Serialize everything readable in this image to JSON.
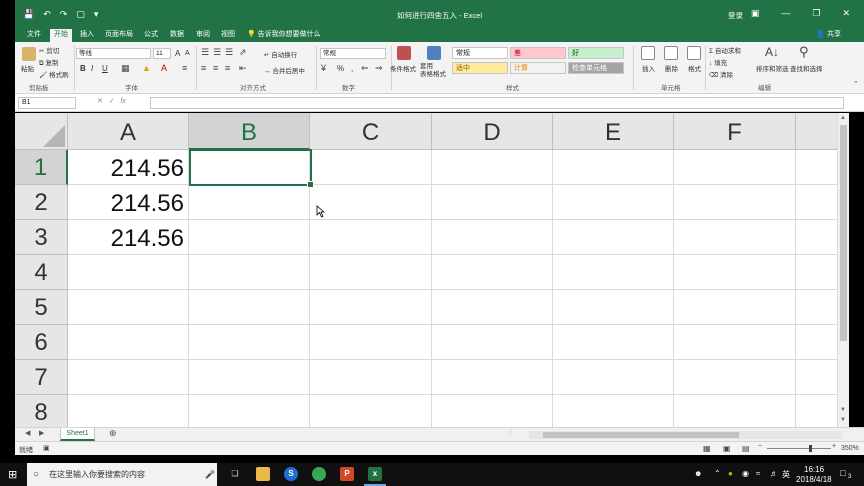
{
  "title_bar": {
    "doc_title": "如何进行四舍五入 - Excel",
    "login": "登录",
    "share": "共享",
    "qat_icons": [
      "save-icon",
      "undo-icon",
      "redo-icon",
      "new-file-icon",
      "customize-icon"
    ]
  },
  "ribbon_tabs": [
    "文件",
    "开始",
    "插入",
    "页面布局",
    "公式",
    "数据",
    "审阅",
    "视图"
  ],
  "active_tab": "开始",
  "tell_me": "告诉我你想要做什么",
  "clipboard": {
    "paste": "粘贴",
    "cut": "剪切",
    "copy": "复制",
    "format_painter": "格式刷",
    "label": "剪贴板"
  },
  "font": {
    "name": "等线",
    "size": "11",
    "label": "字体",
    "bold": "B",
    "italic": "I",
    "underline": "U",
    "grow": "A",
    "shrink": "A"
  },
  "alignment": {
    "wrap": "自动换行",
    "merge": "合并后居中",
    "label": "对齐方式"
  },
  "number": {
    "format": "常规",
    "percent": "%",
    "comma": ",",
    "label": "数字"
  },
  "styles": {
    "conditional": "条件格式",
    "table": "套用\n表格格式",
    "cells": [
      {
        "label": "常规",
        "bg": "#ffffff",
        "fg": "#222222"
      },
      {
        "label": "差",
        "bg": "#ffc7ce",
        "fg": "#9c0006"
      },
      {
        "label": "好",
        "bg": "#c6efce",
        "fg": "#006100"
      },
      {
        "label": "适中",
        "bg": "#ffeb9c",
        "fg": "#9c5700"
      },
      {
        "label": "计算",
        "bg": "#f2f2f2",
        "fg": "#fa7d00"
      },
      {
        "label": "检查单元格",
        "bg": "#a5a5a5",
        "fg": "#ffffff"
      }
    ],
    "label": "样式"
  },
  "cells_group": {
    "insert": "插入",
    "delete": "删除",
    "format": "格式",
    "label": "单元格"
  },
  "editing": {
    "autosum": "自动求和",
    "fill": "填充",
    "clear": "清除",
    "sort": "排序和筛选",
    "find": "查找和选择",
    "label": "编辑"
  },
  "formula_bar": {
    "name_box": "B1",
    "fx": "fx",
    "value": ""
  },
  "columns": [
    "A",
    "B",
    "C",
    "D",
    "E",
    "F"
  ],
  "selected_column": "B",
  "rows": [
    "1",
    "2",
    "3",
    "4",
    "5",
    "6",
    "7",
    "8"
  ],
  "selected_row": "1",
  "column_a_values": [
    "214.56",
    "214.56",
    "214.56"
  ],
  "sheet_tabs": [
    "Sheet1"
  ],
  "status": {
    "mode": "就绪",
    "zoom": "350%"
  },
  "taskbar": {
    "search_placeholder": "在这里输入你要搜索的内容",
    "ime": "英",
    "time": "16:16",
    "date": "2018/4/18",
    "notifications": "3"
  }
}
